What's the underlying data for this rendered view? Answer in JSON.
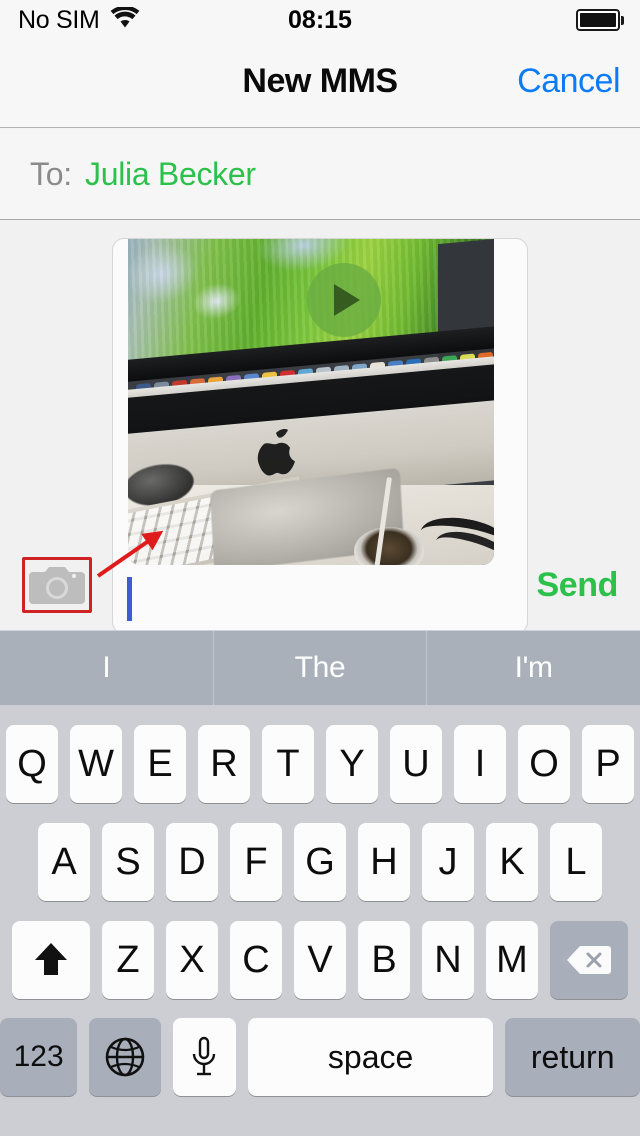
{
  "status_bar": {
    "carrier": "No SIM",
    "wifi_icon": "wifi-icon",
    "time": "08:15",
    "battery_icon": "battery-full-icon"
  },
  "nav_bar": {
    "title": "New MMS",
    "cancel_label": "Cancel",
    "cancel_color": "#0b7bf7"
  },
  "recipient_field": {
    "label": "To:",
    "value": "Julia Becker",
    "value_color": "#2bc14a",
    "label_color": "#8b8b8b"
  },
  "compose": {
    "attachment": {
      "type": "video",
      "play_icon": "play-icon",
      "description": "iMac desktop video thumbnail"
    },
    "message_input": {
      "value": "",
      "placeholder": ""
    },
    "camera_button_icon": "camera-icon",
    "send_label": "Send",
    "send_color": "#2bc14a",
    "annotation": {
      "highlight_color": "#cf2222",
      "arrow_color": "#e01b1b",
      "target": "camera-icon"
    }
  },
  "predictive_bar": {
    "suggestions": [
      "I",
      "The",
      "I'm"
    ],
    "background": "#aab0ba"
  },
  "keyboard": {
    "row1": [
      "Q",
      "W",
      "E",
      "R",
      "T",
      "Y",
      "U",
      "I",
      "O",
      "P"
    ],
    "row2": [
      "A",
      "S",
      "D",
      "F",
      "G",
      "H",
      "J",
      "K",
      "L"
    ],
    "row3_shift_icon": "shift-icon",
    "row3": [
      "Z",
      "X",
      "C",
      "V",
      "B",
      "N",
      "M"
    ],
    "row3_delete_icon": "delete-icon",
    "numbers_label": "123",
    "globe_icon": "globe-icon",
    "mic_icon": "microphone-icon",
    "space_label": "space",
    "return_label": "return"
  }
}
